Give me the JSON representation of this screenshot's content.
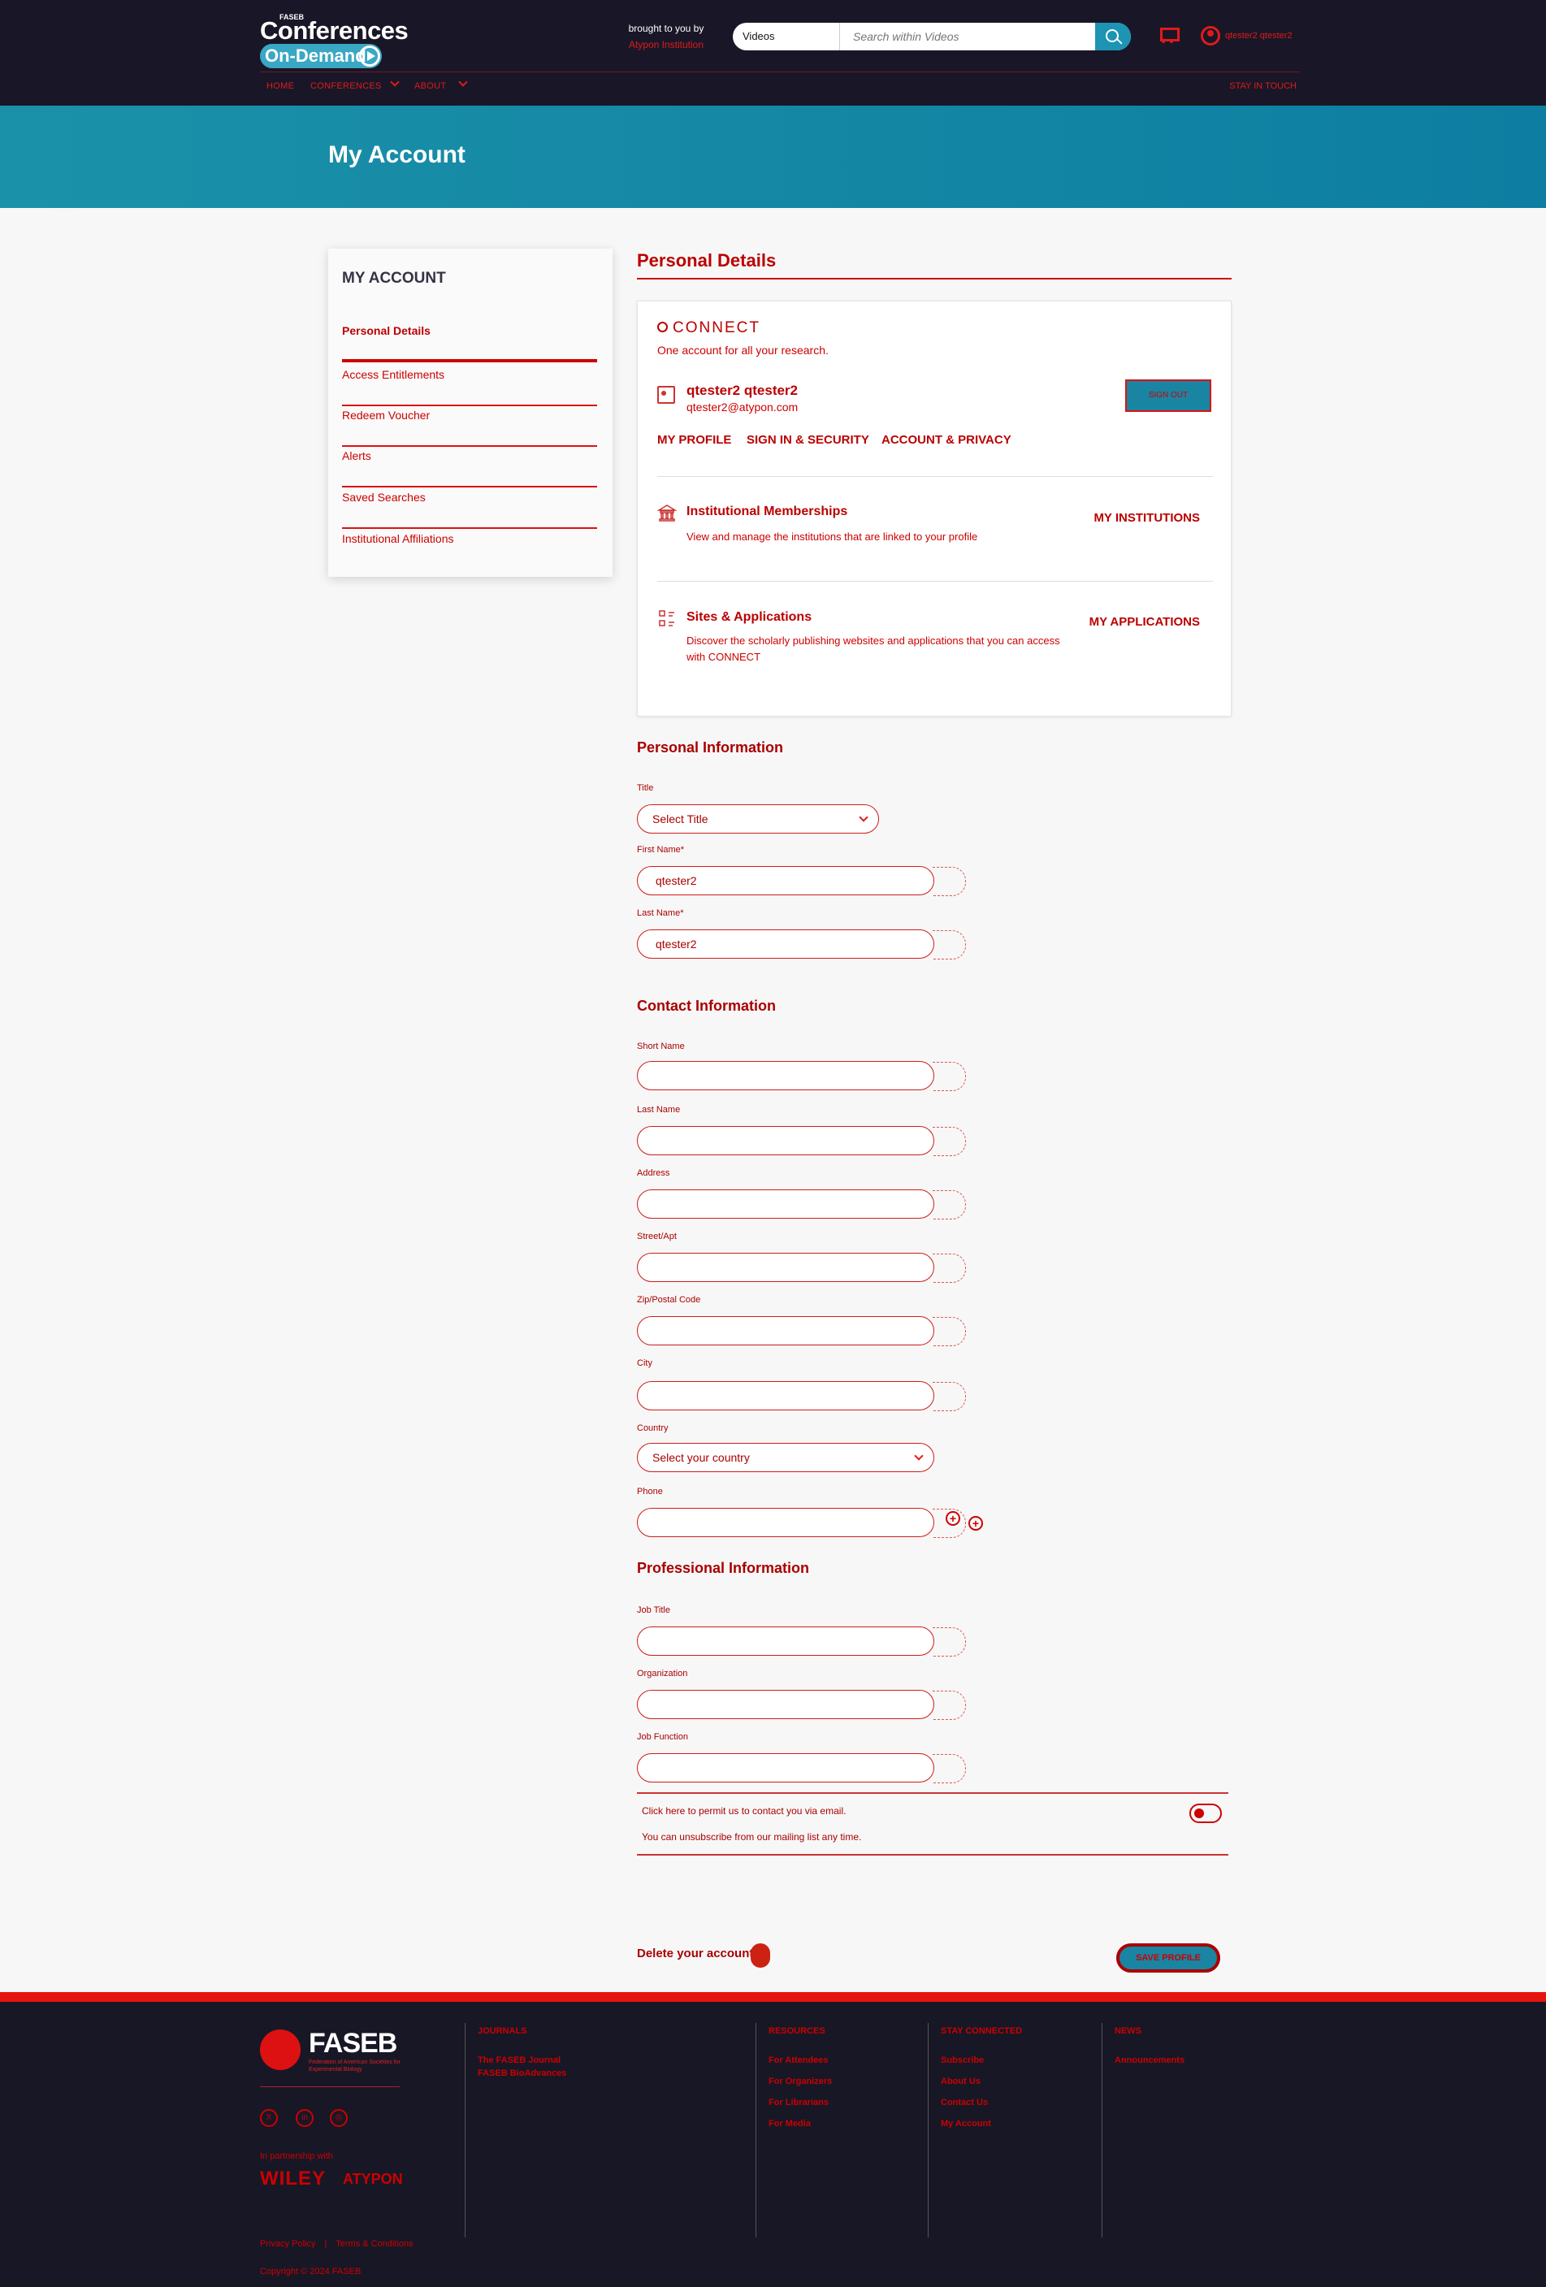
{
  "header": {
    "logo_small": "FASEB",
    "logo_title": "Conferences",
    "logo_pill": "On-Demand",
    "brought_by": "brought to you by",
    "institution": "Atypon Institution",
    "search": {
      "scope": "Videos",
      "placeholder": "Search within Videos"
    },
    "user_name": "qtester2 qtester2",
    "nav": {
      "home": "HOME",
      "conferences": "CONFERENCES",
      "about": "ABOUT",
      "stay_in_touch": "STAY IN TOUCH"
    }
  },
  "banner": {
    "title": "My Account"
  },
  "sidebar": {
    "title": "MY ACCOUNT",
    "items": [
      {
        "label": "Personal Details"
      },
      {
        "label": "Access Entitlements"
      },
      {
        "label": "Redeem Voucher"
      },
      {
        "label": "Alerts"
      },
      {
        "label": "Saved Searches"
      },
      {
        "label": "Institutional Affiliations"
      }
    ]
  },
  "main": {
    "title": "Personal Details",
    "connect": {
      "logo": "CONNECT",
      "tagline": "One account for all your research.",
      "name": "qtester2 qtester2",
      "email": "qtester2@atypon.com",
      "signout": "SIGN OUT",
      "tabs": [
        "MY PROFILE",
        "SIGN IN & SECURITY",
        "ACCOUNT & PRIVACY"
      ],
      "memberships": {
        "title": "Institutional Memberships",
        "desc": "View and manage the institutions that are linked to your profile",
        "link": "MY INSTITUTIONS"
      },
      "sites": {
        "title": "Sites & Applications",
        "desc": "Discover the scholarly publishing websites and applications that you can access with CONNECT",
        "link": "MY APPLICATIONS"
      }
    },
    "personal_info": {
      "heading": "Personal Information",
      "title_label": "Title",
      "title_value": "Select Title",
      "first_name_label": "First Name*",
      "first_name_value": "qtester2",
      "last_name_label": "Last Name*",
      "last_name_value": "qtester2"
    },
    "contact_info": {
      "heading": "Contact Information",
      "short_name_label": "Short Name",
      "last_name_label": "Last Name",
      "address_label": "Address",
      "street_label": "Street/Apt",
      "zip_label": "Zip/Postal Code",
      "city_label": "City",
      "country_label": "Country",
      "country_value": "Select your country",
      "phone_label": "Phone"
    },
    "professional_info": {
      "heading": "Professional Information",
      "job_title_label": "Job Title",
      "organization_label": "Organization",
      "job_function_label": "Job Function"
    },
    "consent": {
      "text": "Click here to permit us to contact you via email.",
      "note": "You can unsubscribe from our mailing list any time."
    },
    "delete_label": "Delete your account.",
    "save_label": "SAVE PROFILE"
  },
  "footer": {
    "logo": "FASEB",
    "logo_sub": "Federation of American Societies for Experimental Biology",
    "partner": "In partnership with",
    "wiley": "WILEY",
    "atypon": "ATYPON",
    "journals": {
      "heading": "JOURNALS",
      "links": [
        "The FASEB Journal",
        "FASEB BioAdvances"
      ]
    },
    "resources": {
      "heading": "RESOURCES",
      "links": [
        "For Attendees",
        "For Organizers",
        "For Librarians",
        "For Media"
      ]
    },
    "stay_connected": {
      "heading": "STAY CONNECTED",
      "links": [
        "Subscribe",
        "About Us",
        "Contact Us",
        "My Account"
      ]
    },
    "news": {
      "heading": "NEWS",
      "links": [
        "Announcements"
      ]
    },
    "privacy": "Privacy Policy",
    "terms": "Terms & Conditions",
    "copyright": "Copyright © 2024 FASEB"
  }
}
